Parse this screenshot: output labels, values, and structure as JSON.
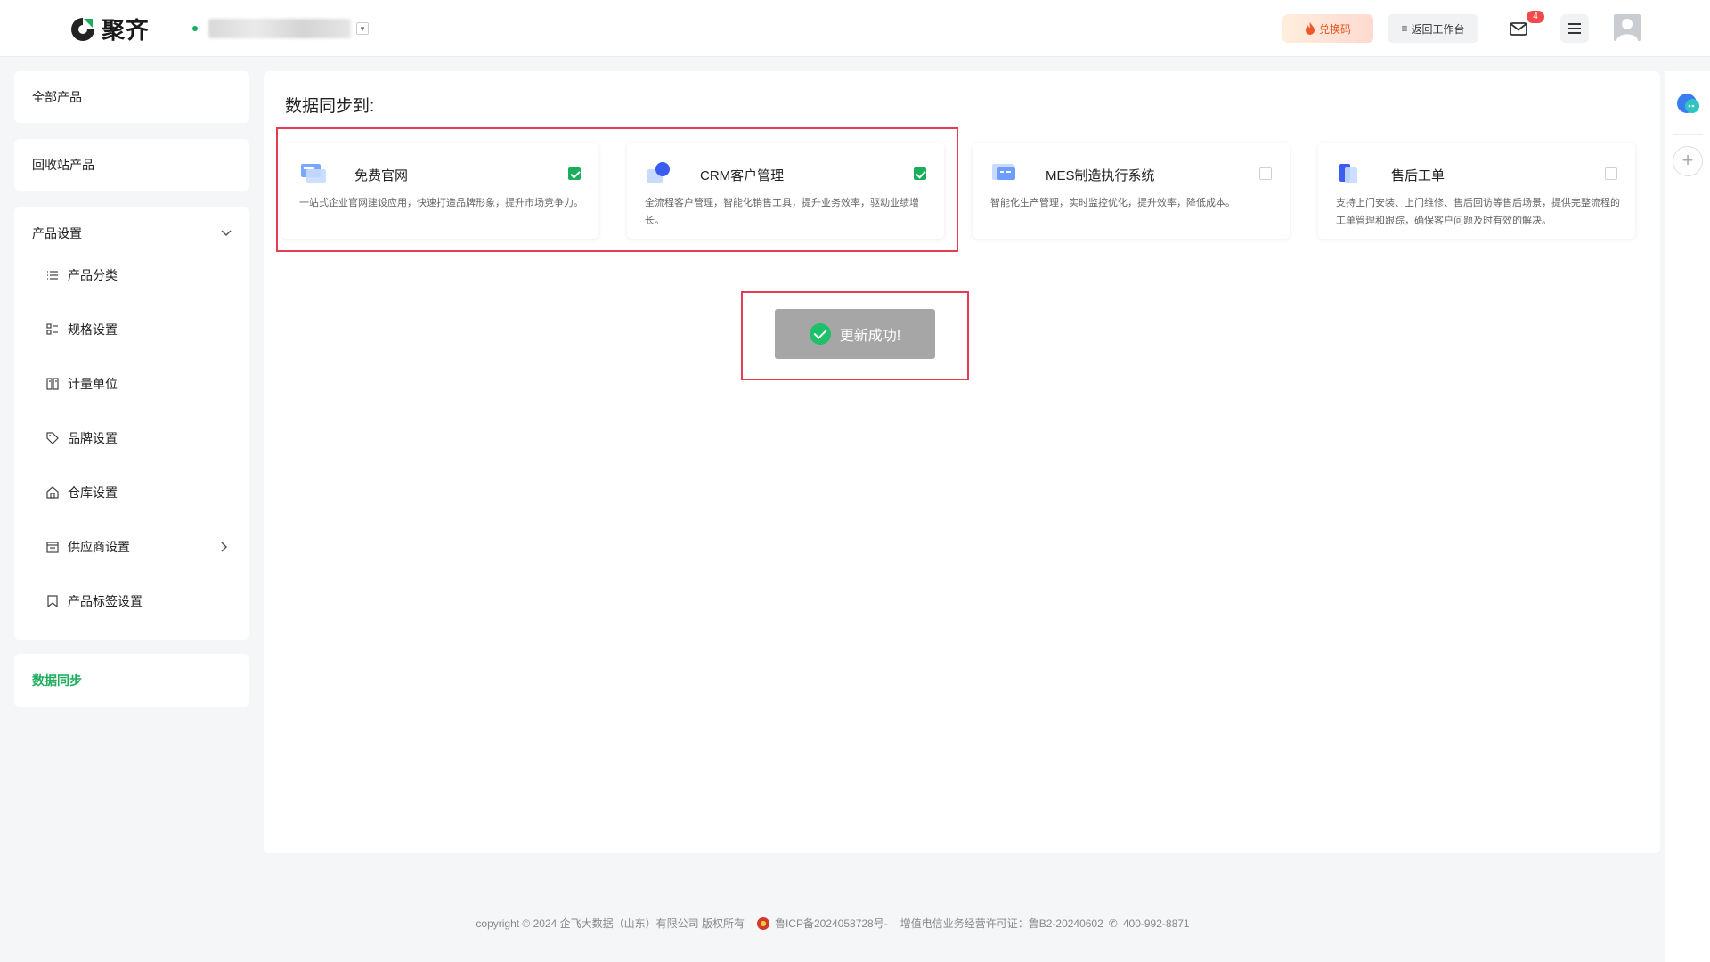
{
  "header": {
    "brand": "聚齐",
    "org_initial": "",
    "redeem_label": "兑换码",
    "back_label": "返回工作台",
    "mail_count": "4"
  },
  "sidebar": {
    "all_products": "全部产品",
    "recycle_products": "回收站产品",
    "settings": {
      "title": "产品设置",
      "items": [
        {
          "label": "产品分类",
          "icon": "list-icon"
        },
        {
          "label": "规格设置",
          "icon": "spec-icon"
        },
        {
          "label": "计量单位",
          "icon": "unit-icon"
        },
        {
          "label": "品牌设置",
          "icon": "tag-icon"
        },
        {
          "label": "仓库设置",
          "icon": "warehouse-icon"
        },
        {
          "label": "供应商设置",
          "icon": "supplier-icon"
        },
        {
          "label": "产品标签设置",
          "icon": "bookmark-icon"
        }
      ]
    },
    "data_sync": "数据同步"
  },
  "main": {
    "title": "数据同步到:",
    "products": [
      {
        "title": "免费官网",
        "desc": "一站式企业官网建设应用，快速打造品牌形象，提升市场竞争力。",
        "checked": true
      },
      {
        "title": "CRM客户管理",
        "desc": "全流程客户管理，智能化销售工具，提升业务效率，驱动业绩增长。",
        "checked": true
      },
      {
        "title": "MES制造执行系统",
        "desc": "智能化生产管理，实时监控优化，提升效率，降低成本。",
        "checked": false
      },
      {
        "title": "售后工单",
        "desc": "支持上门安装、上门维修、售后回访等售后场景，提供完整流程的工单管理和跟踪，确保客户问题及时有效的解决。",
        "checked": false
      }
    ],
    "toast": "更新成功!"
  },
  "footer": {
    "copyright": "copyright © 2024 企飞大数据（山东）有限公司 版权所有",
    "icp": "鲁ICP备2024058728号-",
    "license": "增值电信业务经营许可证：鲁B2-20240602",
    "phone": "400-992-8871"
  },
  "colors": {
    "accent": "#1aad5b",
    "highlight": "#e63b55"
  }
}
